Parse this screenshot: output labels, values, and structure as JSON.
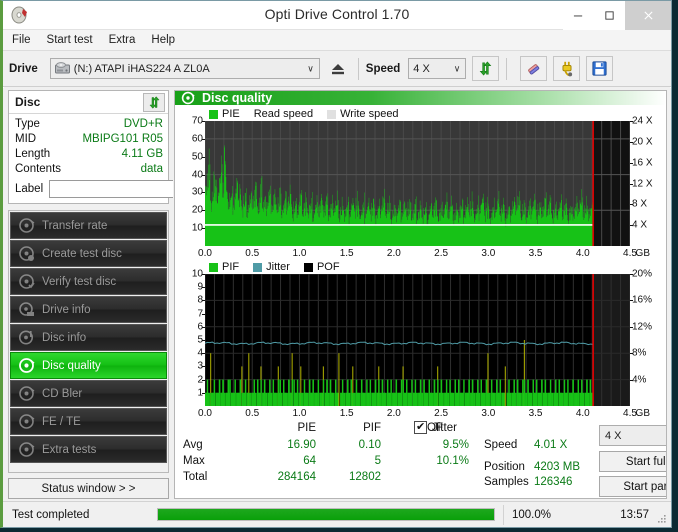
{
  "window": {
    "title": "Opti Drive Control 1.70",
    "icon": "disc-icon",
    "minimize": "–",
    "maximize": "☐",
    "close": "×"
  },
  "menubar": {
    "items": [
      {
        "label": "File"
      },
      {
        "label": "Start test"
      },
      {
        "label": "Extra"
      },
      {
        "label": "Help"
      }
    ]
  },
  "toolbar": {
    "drive_label": "Drive",
    "drive_value": "(N:)  ATAPI iHAS224  A ZL0A",
    "drive_icon": "drive-icon",
    "eject_icon": "eject-icon",
    "speed_label": "Speed",
    "speed_value": "4 X",
    "refresh_icon": "refresh-arrows-icon",
    "erase_icon": "eraser-icon",
    "plug_icon": "plug-icon",
    "save_icon": "floppy-save-icon",
    "dropdown_arrow": "∨"
  },
  "disc_panel": {
    "title": "Disc",
    "refresh_icon": "refresh-arrows-icon",
    "rows": [
      {
        "key": "Type",
        "value": "DVD+R"
      },
      {
        "key": "MID",
        "value": "MBIPG101 R05"
      },
      {
        "key": "Length",
        "value": "4.11 GB"
      },
      {
        "key": "Contents",
        "value": "data"
      }
    ],
    "label_key": "Label",
    "label_value": "",
    "label_placeholder": "",
    "label_button_icon": "disc-cd-icon"
  },
  "sidebar": {
    "items": [
      {
        "label": "Transfer rate",
        "icon": "disc-icon",
        "active": false
      },
      {
        "label": "Create test disc",
        "icon": "disc-write-icon",
        "active": false
      },
      {
        "label": "Verify test disc",
        "icon": "disc-check-icon",
        "active": false
      },
      {
        "label": "Drive info",
        "icon": "drive-info-icon",
        "active": false
      },
      {
        "label": "Disc info",
        "icon": "disc-info-icon",
        "active": false
      },
      {
        "label": "Disc quality",
        "icon": "disc-quality-icon",
        "active": true
      },
      {
        "label": "CD Bler",
        "icon": "disc-icon",
        "active": false
      },
      {
        "label": "FE / TE",
        "icon": "disc-icon",
        "active": false
      },
      {
        "label": "Extra tests",
        "icon": "disc-icon",
        "active": false
      }
    ],
    "status_window_button": "Status window > >"
  },
  "main": {
    "panel_title": "Disc quality",
    "panel_icon": "disc-quality-icon"
  },
  "stats": {
    "columns": [
      "PIE",
      "PIF",
      "POF",
      "Jitter"
    ],
    "jitter_checked": true,
    "rows": [
      {
        "label": "Avg",
        "pie": "16.90",
        "pif": "0.10",
        "pof": "",
        "jitter": "9.5%"
      },
      {
        "label": "Max",
        "pie": "64",
        "pif": "5",
        "pof": "",
        "jitter": "10.1%"
      },
      {
        "label": "Total",
        "pie": "284164",
        "pif": "12802",
        "pof": "",
        "jitter": ""
      }
    ],
    "speed_label": "Speed",
    "speed_value": "4.01 X",
    "position_label": "Position",
    "position_value": "4203 MB",
    "samples_label": "Samples",
    "samples_value": "126346",
    "speed_select_value": "4 X",
    "start_full_button": "Start full",
    "start_part_button": "Start part",
    "dropdown_arrow": "∨"
  },
  "statusbar": {
    "text": "Test completed",
    "progress_percent": "100.0%",
    "progress_value": 100,
    "elapsed": "13:57",
    "grip_icon": "resize-grip-icon"
  },
  "chart_data": [
    {
      "type": "area",
      "name": "pie-chart",
      "title": "PIE",
      "legend": [
        {
          "label": "PIE",
          "color": "#17c217",
          "swatch": true
        },
        {
          "label": "Read speed",
          "color": "#ffffff",
          "swatch": false
        },
        {
          "label": "Write speed",
          "color": "#e0e0e0",
          "swatch": true
        }
      ],
      "legend_position": "top-left",
      "xlabel": "GB",
      "ylabel": "PIE",
      "xlim": [
        0.0,
        4.5
      ],
      "xticks": [
        0.0,
        0.5,
        1.0,
        1.5,
        2.0,
        2.5,
        3.0,
        3.5,
        4.0,
        4.5
      ],
      "xticklabels": [
        "0.0",
        "0.5",
        "1.0",
        "1.5",
        "2.0",
        "2.5",
        "3.0",
        "3.5",
        "4.0",
        "4.5"
      ],
      "ylim": [
        0,
        70
      ],
      "yticks": [
        10,
        20,
        30,
        40,
        50,
        60,
        70
      ],
      "yticklabels": [
        "10",
        "20",
        "30",
        "40",
        "50",
        "60",
        "70"
      ],
      "y2lim": [
        0,
        24
      ],
      "y2ticks": [
        4,
        8,
        12,
        16,
        20,
        24
      ],
      "y2ticklabels": [
        "4 X",
        "8 X",
        "12 X",
        "16 X",
        "20 X",
        "24 X"
      ],
      "grid": true,
      "data_end_marker": 4.11,
      "read_speed_line": [
        {
          "x": 0.0,
          "y": 11.8
        },
        {
          "x": 4.11,
          "y": 11.8
        }
      ],
      "series": [
        {
          "name": "PIE",
          "color": "#17c217",
          "values": [
            38,
            42,
            57,
            30,
            35,
            48,
            41,
            33,
            44,
            52,
            36,
            63,
            40,
            31,
            34,
            38,
            28,
            33,
            42,
            30,
            36,
            26,
            31,
            38,
            24,
            29,
            34,
            27,
            32,
            40,
            25,
            30,
            45,
            28,
            33,
            26,
            31,
            37,
            24,
            29,
            35,
            26,
            30,
            38,
            23,
            28,
            33,
            25,
            30,
            36,
            22,
            27,
            32,
            24,
            29,
            34,
            21,
            26,
            31,
            23,
            28,
            33,
            20,
            25,
            30,
            22,
            27,
            32,
            24,
            28,
            35,
            21,
            26,
            30,
            23,
            27,
            31,
            19,
            24,
            29,
            22,
            26,
            30,
            20,
            25,
            29,
            23,
            27,
            32,
            21,
            25,
            30,
            19,
            24,
            28,
            22,
            26,
            31,
            20,
            24,
            29,
            23,
            28,
            33,
            21,
            25,
            30,
            18,
            23,
            27,
            21,
            25,
            29,
            19,
            24,
            28,
            22,
            26,
            31,
            20,
            24,
            29,
            17,
            22,
            26,
            20,
            24,
            28,
            18,
            23,
            27,
            21,
            25,
            30,
            19,
            23,
            28,
            22,
            27,
            31,
            20,
            25,
            29,
            18,
            22,
            27,
            21,
            26,
            30,
            19,
            24,
            28,
            22,
            26,
            31,
            20,
            24,
            29,
            23,
            27,
            32,
            21,
            25,
            30,
            19,
            23,
            28,
            22,
            26,
            31,
            20,
            25,
            29,
            18,
            23,
            27,
            21,
            26,
            30,
            24,
            28,
            33,
            20,
            25,
            29,
            19,
            24,
            28,
            22,
            27,
            31,
            20,
            25,
            30,
            23,
            27,
            32,
            21,
            26,
            30,
            19,
            24,
            28,
            22,
            27,
            31,
            20,
            24,
            29,
            18,
            23,
            27,
            21,
            25,
            30,
            23,
            28,
            32,
            20,
            25,
            29,
            22,
            26,
            31
          ]
        }
      ]
    },
    {
      "type": "bar",
      "name": "pif-chart",
      "title": "PIF",
      "legend": [
        {
          "label": "PIF",
          "color": "#17c217",
          "swatch": true
        },
        {
          "label": "Jitter",
          "color": "#4f9ba6",
          "swatch": true
        },
        {
          "label": "POF",
          "color": "#000000",
          "swatch": true
        }
      ],
      "legend_position": "top-left",
      "xlabel": "GB",
      "ylabel": "PIF",
      "xlim": [
        0.0,
        4.5
      ],
      "xticks": [
        0.0,
        0.5,
        1.0,
        1.5,
        2.0,
        2.5,
        3.0,
        3.5,
        4.0,
        4.5
      ],
      "xticklabels": [
        "0.0",
        "0.5",
        "1.0",
        "1.5",
        "2.0",
        "2.5",
        "3.0",
        "3.5",
        "4.0",
        "4.5"
      ],
      "ylim": [
        0,
        10
      ],
      "yticks": [
        1,
        2,
        3,
        4,
        5,
        6,
        7,
        8,
        9,
        10
      ],
      "yticklabels": [
        "1",
        "2",
        "3",
        "4",
        "5",
        "6",
        "7",
        "8",
        "9",
        "10"
      ],
      "y2lim": [
        0,
        20
      ],
      "y2ticks": [
        4,
        8,
        12,
        16,
        20
      ],
      "y2ticklabels": [
        "4%",
        "8%",
        "12%",
        "16%",
        "20%"
      ],
      "grid": true,
      "data_end_marker": 4.11,
      "jitter_line_avg": 9.5,
      "jitter_line_max": 10.1,
      "series": [
        {
          "name": "PIF",
          "color": "#17c217",
          "values": [
            1,
            2,
            1,
            4,
            1,
            2,
            1,
            1,
            2,
            1,
            2,
            1,
            1,
            2,
            2,
            1,
            1,
            2,
            1,
            1,
            2,
            3,
            1,
            2,
            1,
            4,
            1,
            1,
            2,
            1,
            2,
            1,
            3,
            1,
            2,
            1,
            1,
            2,
            1,
            2,
            1,
            1,
            3,
            2,
            1,
            2,
            1,
            1,
            2,
            1,
            4,
            2,
            1,
            2,
            1,
            3,
            1,
            2,
            1,
            1,
            2,
            1,
            2,
            1,
            1,
            2,
            1,
            1,
            3,
            1,
            2,
            1,
            2,
            1,
            1,
            2,
            1,
            4,
            1,
            2,
            1,
            1,
            2,
            1,
            2,
            3,
            1,
            2,
            1,
            1,
            2,
            1,
            1,
            2,
            1,
            2,
            1,
            1,
            2,
            1,
            3,
            1,
            2,
            1,
            1,
            2,
            1,
            2,
            1,
            1,
            2,
            1,
            1,
            2,
            3,
            1,
            2,
            1,
            1,
            2,
            1,
            2,
            1,
            1,
            2,
            1,
            2,
            1,
            1,
            2,
            1,
            1,
            2,
            1,
            3,
            1,
            2,
            1,
            1,
            2,
            1,
            2,
            1,
            1,
            2,
            1,
            2,
            1,
            1,
            2,
            1,
            1,
            2,
            1,
            2,
            1,
            1,
            2,
            1,
            2,
            1,
            1,
            2,
            4,
            1,
            2,
            1,
            1,
            2,
            1,
            2,
            1,
            1,
            3,
            1,
            2,
            1,
            1,
            2,
            1,
            2,
            1,
            1,
            2,
            5,
            1,
            2,
            1,
            1,
            2,
            1,
            2,
            1,
            1,
            2,
            1,
            2,
            1,
            1,
            2,
            1,
            1,
            2,
            1,
            2,
            1,
            1,
            2,
            1,
            2,
            1,
            1,
            2,
            1,
            1,
            2,
            1,
            2,
            1,
            1,
            2,
            1,
            2,
            1
          ]
        }
      ]
    }
  ]
}
